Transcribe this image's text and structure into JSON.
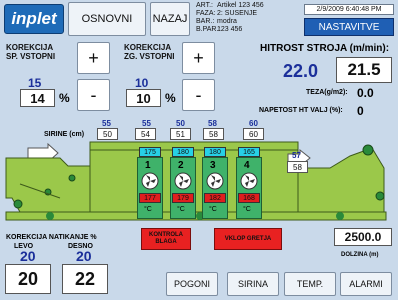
{
  "header": {
    "logo": "inplet",
    "buttons": [
      "OSNOVNI",
      "NAZAJ"
    ],
    "info": [
      {
        "key": "ART.:",
        "value": "Artikel 123 456"
      },
      {
        "key": "FAZA:",
        "value": "2: SUSENJE"
      },
      {
        "key": "BAR.:",
        "value": "modra"
      },
      {
        "key": "B.PAR.:",
        "value": "123 456"
      }
    ],
    "datetime": "2/9/2009 6:40:48 PM",
    "settings_button": "NASTAVITVE"
  },
  "korekcija_sp": {
    "label_line1": "KOREKCIJA",
    "label_line2": "SP. VSTOPNI",
    "plus": "+",
    "minus": "-",
    "setpoint": "15",
    "value": "14",
    "unit": "%"
  },
  "korekcija_zg": {
    "label_line1": "KOREKCIJA",
    "label_line2": "ZG. VSTOPNI",
    "plus": "+",
    "minus": "-",
    "setpoint": "10",
    "value": "10",
    "unit": "%"
  },
  "speed": {
    "label": "HITROST STROJA (m/min):",
    "actual": "22.0",
    "setpoint": "21.5"
  },
  "teza": {
    "label": "TEZA(g/m2):",
    "value": "0.0"
  },
  "napetost": {
    "label": "NAPETOST HT VALJ (%):",
    "value": "0"
  },
  "sirine": {
    "label": "SIRINE (cm)",
    "setpoints": [
      "55",
      "55",
      "50",
      "58",
      "60"
    ],
    "actuals": [
      "50",
      "54",
      "51",
      "58",
      "60"
    ]
  },
  "zones": [
    {
      "number": "1",
      "set": "175",
      "actual": "177",
      "unit": "°C"
    },
    {
      "number": "2",
      "set": "180",
      "actual": "179",
      "unit": "°C"
    },
    {
      "number": "3",
      "set": "180",
      "actual": "182",
      "unit": "°C"
    },
    {
      "number": "4",
      "set": "165",
      "actual": "168",
      "unit": "°C"
    }
  ],
  "outlet_width": {
    "setpoint": "57",
    "actual": "58"
  },
  "controls": {
    "kontrola_line1": "KONTROLA",
    "kontrola_line2": "BLAGA",
    "vklop": "VKLOP GRETJA"
  },
  "natikanje": {
    "label": "KOREKCIJA NATIKANJE %",
    "levo_label": "LEVO",
    "desno_label": "DESNO",
    "levo_set": "20",
    "desno_set": "20",
    "levo_value": "20",
    "desno_value": "22"
  },
  "dolzina": {
    "value": "2500.0",
    "label": "DOLZINA (m)"
  },
  "footer": {
    "buttons": [
      "POGONI",
      "SIRINA",
      "TEMP.",
      "ALARMI"
    ]
  }
}
